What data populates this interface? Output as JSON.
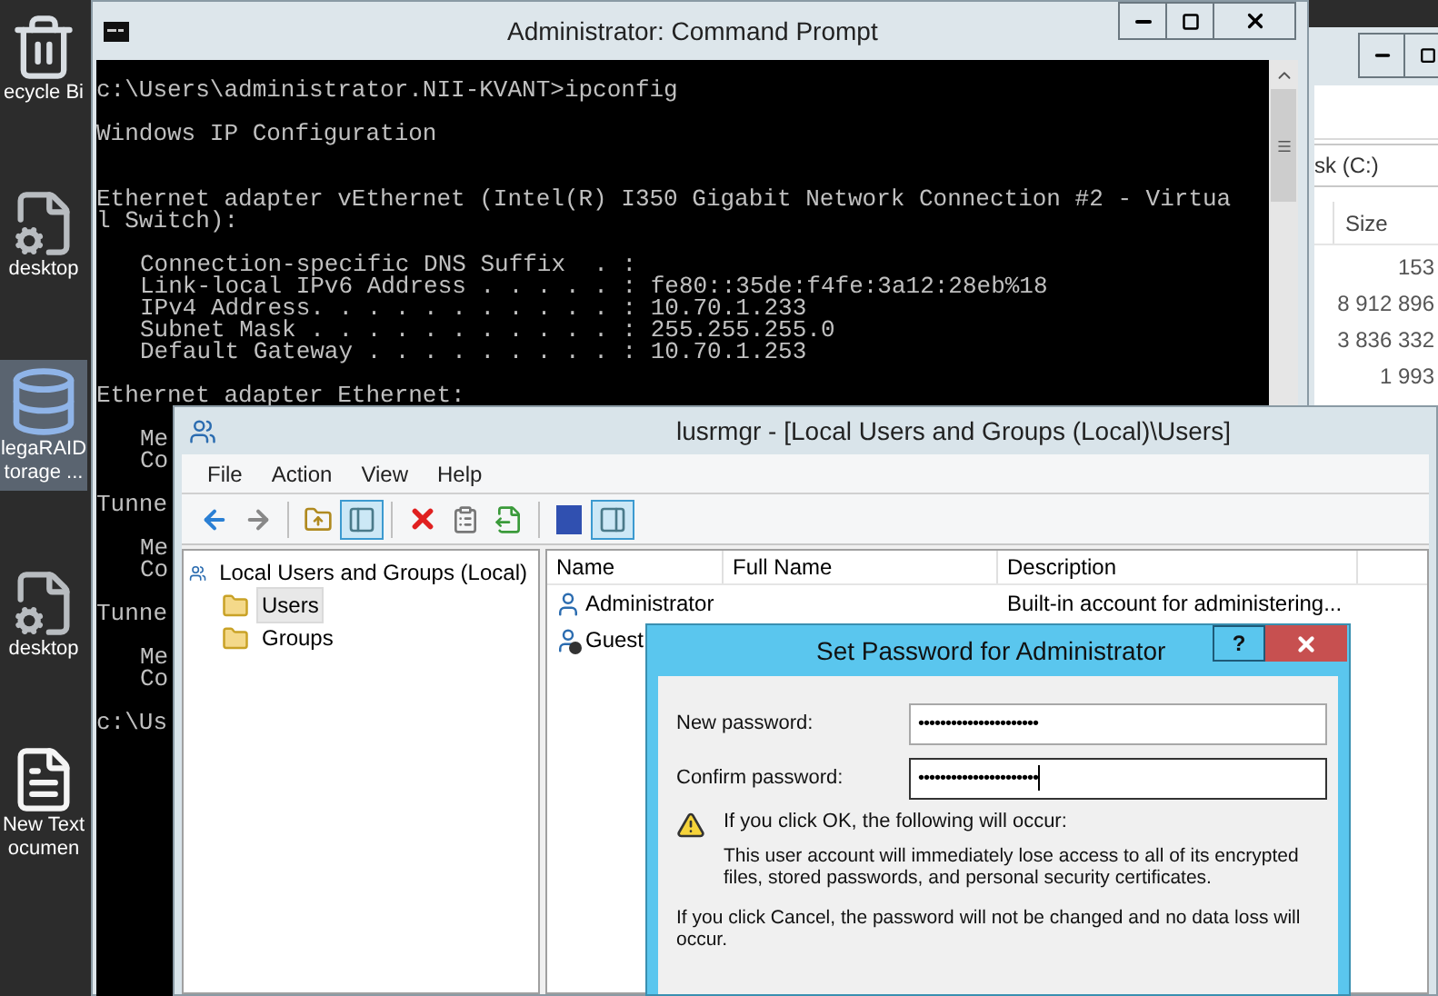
{
  "desktop_icons": [
    {
      "kind": "recycle-bin",
      "label_lines": [
        "ecycle Bi"
      ],
      "selected": false
    },
    {
      "kind": "settings-file",
      "label_lines": [
        "desktop"
      ],
      "selected": false
    },
    {
      "kind": "database",
      "label_lines": [
        "legaRAID",
        "torage ..."
      ],
      "selected": true
    },
    {
      "kind": "settings-file",
      "label_lines": [
        "desktop"
      ],
      "selected": false
    },
    {
      "kind": "text-file",
      "label_lines": [
        "New Text",
        "ocumen"
      ],
      "selected": false
    }
  ],
  "explorer_window": {
    "address": "sk (C:)",
    "column": "Size",
    "sizes": [
      "153",
      "8 912 896",
      "3 836 332",
      "1 993"
    ]
  },
  "cmd_window": {
    "title": "Administrator: Command Prompt",
    "paragraphs": [
      {
        "kind": "plain",
        "lines": [
          "c:\\Users\\administrator.NII-KVANT>ipconfig"
        ]
      },
      {
        "kind": "heading",
        "lines": [
          "Windows IP Configuration"
        ]
      },
      {
        "kind": "plain",
        "lines": [
          "Ethernet adapter vEthernet (Intel(R) I350 Gigabit Network Connection #2 - Virtua",
          "l Switch):"
        ]
      },
      {
        "kind": "detail",
        "lines": [
          "Connection-specific DNS Suffix  . :",
          "Link-local IPv6 Address . . . . . : fe80::35de:f4fe:3a12:28eb%18",
          "IPv4 Address. . . . . . . . . . . : 10.70.1.233",
          "Subnet Mask . . . . . . . . . . . : 255.255.255.0",
          "Default Gateway . . . . . . . . . : 10.70.1.253"
        ]
      },
      {
        "kind": "plain",
        "lines": [
          "Ethernet adapter Ethernet:"
        ]
      },
      {
        "kind": "detail",
        "lines": [
          "Me",
          "Co"
        ]
      },
      {
        "kind": "plain",
        "lines": [
          "Tunne"
        ]
      },
      {
        "kind": "detail",
        "lines": [
          "Me",
          "Co"
        ]
      },
      {
        "kind": "plain",
        "lines": [
          "Tunne"
        ]
      },
      {
        "kind": "detail",
        "lines": [
          "Me",
          "Co"
        ]
      },
      {
        "kind": "plain",
        "lines": [
          "c:\\Us"
        ]
      }
    ]
  },
  "lusrmgr_window": {
    "title": "lusrmgr - [Local Users and Groups (Local)\\Users]",
    "menu": [
      "File",
      "Action",
      "View",
      "Help"
    ],
    "toolbar": [
      {
        "kind": "back",
        "pressed": false
      },
      {
        "kind": "forward",
        "pressed": false
      },
      {
        "kind": "separator"
      },
      {
        "kind": "up",
        "pressed": false
      },
      {
        "kind": "tree",
        "pressed": true
      },
      {
        "kind": "separator"
      },
      {
        "kind": "delete",
        "pressed": false
      },
      {
        "kind": "properties",
        "pressed": false
      },
      {
        "kind": "export",
        "pressed": false
      },
      {
        "kind": "separator"
      },
      {
        "kind": "help",
        "pressed": false
      },
      {
        "kind": "action-pane",
        "pressed": true
      }
    ],
    "tree": [
      {
        "label": "Local Users and Groups (Local)",
        "selected": false,
        "children": [
          {
            "label": "Users",
            "selected": true
          },
          {
            "label": "Groups",
            "selected": false
          }
        ]
      }
    ],
    "columns": [
      "Name",
      "Full Name",
      "Description"
    ],
    "rows": [
      {
        "name": "Administrator",
        "description": "Built-in account for administering...",
        "disabled": false
      },
      {
        "name": "Guest",
        "disabled": true
      }
    ]
  },
  "dialog": {
    "title": "Set Password for Administrator",
    "help_button": "?",
    "fields": [
      {
        "label": "New password:",
        "value": "••••••••••••••••••••••",
        "focused": false
      },
      {
        "label": "Confirm password:",
        "value": "••••••••••••••••••••••",
        "focused": true
      }
    ],
    "warning": "If you click OK, the following will occur:",
    "warning_detail": "This user account will immediately lose access to all of its encrypted files, stored passwords, and personal security certificates.",
    "note": "If you click Cancel, the password will not be changed and no data loss will occur."
  }
}
